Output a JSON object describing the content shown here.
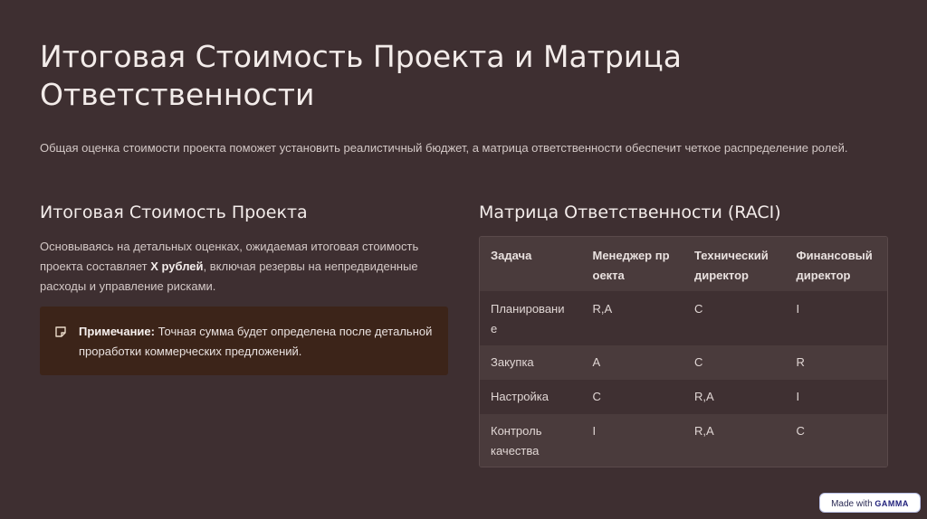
{
  "title": "Итоговая Стоимость Проекта и Матрица Ответственности",
  "subtitle": "Общая оценка стоимости проекта поможет установить реалистичный бюджет, а матрица ответственности обеспечит четкое распределение ролей.",
  "cost_section": {
    "heading": "Итоговая Стоимость Проекта",
    "para_before": "Основываясь на детальных оценках, ожидаемая итоговая стоимость проекта составляет ",
    "para_bold": "X рублей",
    "para_after": ", включая резервы на непредвиденные расходы и управление рисками.",
    "note_label": "Примечание:",
    "note_text": " Точная сумма будет определена после детальной проработки коммерческих предложений.",
    "note_icon": "note-icon"
  },
  "raci_section": {
    "heading": "Матрица Ответственности (RACI)",
    "headers": [
      "Задача",
      "Менеджер проекта",
      "Технический директор",
      "Финансовый директор"
    ],
    "rows": [
      [
        "Планирование",
        "R,A",
        "C",
        "I"
      ],
      [
        "Закупка",
        "A",
        "C",
        "R"
      ],
      [
        "Настройка",
        "C",
        "R,A",
        "I"
      ],
      [
        "Контроль качества",
        "I",
        "R,A",
        "C"
      ]
    ]
  },
  "badge": {
    "prefix": "Made with ",
    "brand": "GAMMA"
  }
}
